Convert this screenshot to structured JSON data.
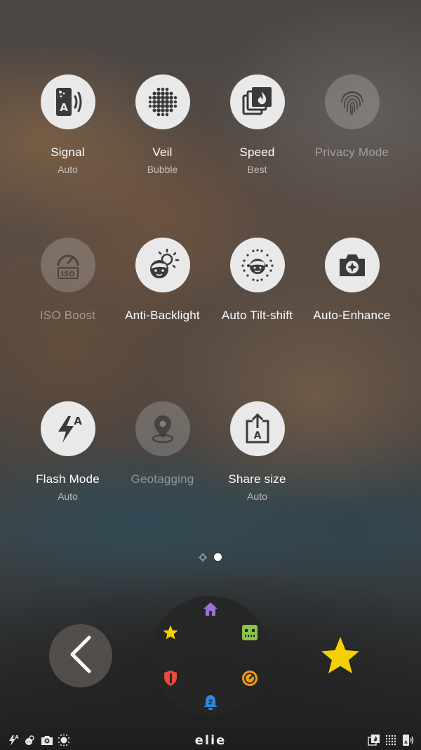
{
  "tiles": [
    {
      "label": "Signal",
      "sub": "Auto",
      "icon": "signal-card-icon",
      "enabled": true
    },
    {
      "label": "Veil",
      "sub": "Bubble",
      "icon": "dot-grid-icon",
      "enabled": true
    },
    {
      "label": "Speed",
      "sub": "Best",
      "icon": "stacked-photos-flame-icon",
      "enabled": true
    },
    {
      "label": "Privacy Mode",
      "sub": "",
      "icon": "fingerprint-icon",
      "enabled": false
    },
    {
      "label": "ISO Boost",
      "sub": "",
      "icon": "iso-gauge-icon",
      "enabled": false
    },
    {
      "label": "Anti-Backlight",
      "sub": "",
      "icon": "face-sun-icon",
      "enabled": true
    },
    {
      "label": "Auto Tilt-shift",
      "sub": "",
      "icon": "face-dots-icon",
      "enabled": true
    },
    {
      "label": "Auto-Enhance",
      "sub": "",
      "icon": "camera-sparkle-icon",
      "enabled": true
    },
    {
      "label": "Flash Mode",
      "sub": "Auto",
      "icon": "flash-auto-icon",
      "enabled": true
    },
    {
      "label": "Geotagging",
      "sub": "",
      "icon": "location-pin-icon",
      "enabled": false
    },
    {
      "label": "Share size",
      "sub": "Auto",
      "icon": "share-size-icon",
      "enabled": true
    }
  ],
  "pager": {
    "current_page": 2,
    "total_pages": 2
  },
  "dial": {
    "items": [
      {
        "icon": "home-icon",
        "color": "#9b6fd6"
      },
      {
        "icon": "robot-icon",
        "color": "#8bc34a"
      },
      {
        "icon": "gauge-icon",
        "color": "#f39c12"
      },
      {
        "icon": "bell-z-icon",
        "color": "#2e86de"
      },
      {
        "icon": "shield-icon",
        "color": "#e74c3c"
      },
      {
        "icon": "star-icon",
        "color": "#f5d000"
      }
    ]
  },
  "accent_star_color": "#f5d000",
  "statusbar": {
    "brand": "elie",
    "left_icons": [
      "flash-auto-icon",
      "anti-backlight-icon",
      "camera-sparkle-icon",
      "tilt-shift-icon"
    ],
    "right_icons": [
      "speed-icon",
      "veil-icon",
      "signal-icon"
    ]
  }
}
